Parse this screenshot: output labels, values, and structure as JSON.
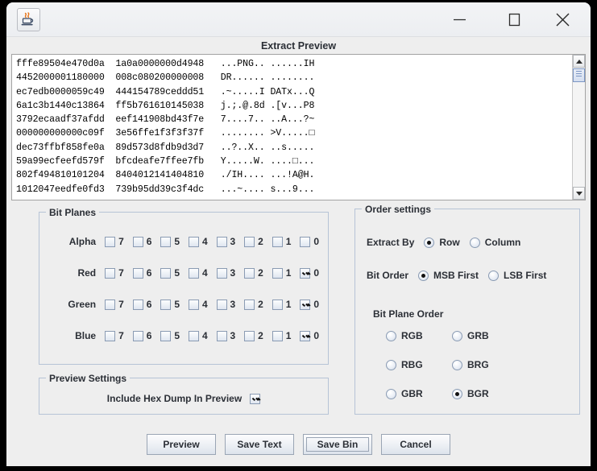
{
  "window": {
    "app_icon": "java-coffee-cup-icon",
    "minimize_label": "minimize-icon",
    "maximize_label": "maximize-icon",
    "close_label": "close-icon"
  },
  "dialog": {
    "title": "Extract Preview"
  },
  "hexdump": {
    "text": "fffe89504e470d0a  1a0a0000000d4948   ...PNG.. ......IH\n4452000001180000  008c080200000008   DR...... ........\nec7edb0000059c49  444154789ceddd51   .~.....I DATx...Q\n6a1c3b1440c13864  ff5b761610145038   j.;.@.8d .[v...P8\n3792ecaadf37afdd  eef141908bd43f7e   7....7.. ..A...?~\n000000000000c09f  3e56ffe1f3f3f37f   ........ >V.....□\ndec73ffbf858fe0a  89d573d8fdb9d3d7   ..?..X.. ..s.....\n59a99ecfeefd579f  bfcdeafe7ffee7fb   Y.....W. ....□...\n802f494810101204  8404012141404810   ./IH.... ...!A@H.\n1012047eedfe0fd3  739b95dd39c3f4dc   ...~.... s...9..."
  },
  "scrollbar": {
    "up_icon": "scroll-up-arrow-icon",
    "down_icon": "scroll-down-arrow-icon"
  },
  "bit_planes": {
    "title": "Bit Planes",
    "bit_labels": [
      "7",
      "6",
      "5",
      "4",
      "3",
      "2",
      "1",
      "0"
    ],
    "channels": [
      {
        "name": "Alpha",
        "checked": [
          false,
          false,
          false,
          false,
          false,
          false,
          false,
          false
        ]
      },
      {
        "name": "Red",
        "checked": [
          false,
          false,
          false,
          false,
          false,
          false,
          false,
          true
        ]
      },
      {
        "name": "Green",
        "checked": [
          false,
          false,
          false,
          false,
          false,
          false,
          false,
          true
        ]
      },
      {
        "name": "Blue",
        "checked": [
          false,
          false,
          false,
          false,
          false,
          false,
          false,
          true
        ]
      }
    ]
  },
  "preview_settings": {
    "title": "Preview Settings",
    "include_hex_dump_label": "Include Hex Dump In Preview",
    "include_hex_dump_checked": true
  },
  "order_settings": {
    "title": "Order settings",
    "extract_by_label": "Extract By",
    "extract_by_options": [
      "Row",
      "Column"
    ],
    "extract_by_selected": "Row",
    "bit_order_label": "Bit Order",
    "bit_order_options": [
      "MSB First",
      "LSB First"
    ],
    "bit_order_selected": "MSB First",
    "bit_plane_order_label": "Bit Plane Order",
    "bit_plane_order_options": [
      "RGB",
      "GRB",
      "RBG",
      "BRG",
      "GBR",
      "BGR"
    ],
    "bit_plane_order_selected": "BGR"
  },
  "buttons": {
    "preview": "Preview",
    "save_text": "Save Text",
    "save_bin": "Save Bin",
    "cancel": "Cancel",
    "focused": "Save Bin"
  },
  "colors": {
    "window_bg": "#eeeeee",
    "panel_border": "#b6c3d6",
    "text": "#2b2f36",
    "textarea_bg": "#ffffff",
    "desktop": "#000000"
  }
}
